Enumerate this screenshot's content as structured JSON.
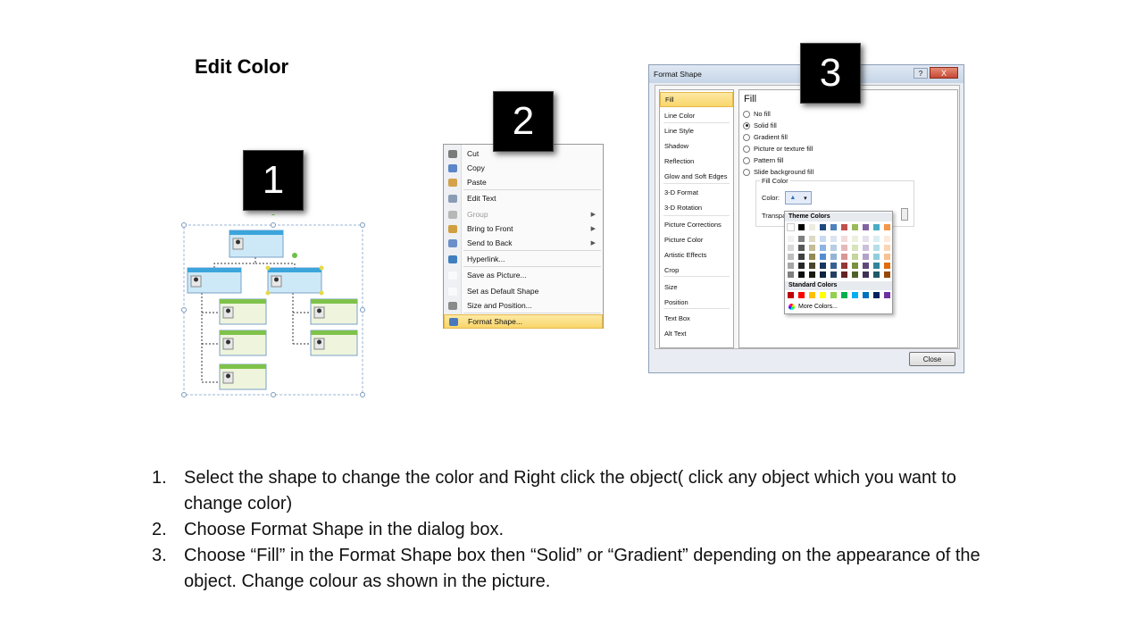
{
  "title": "Edit Color",
  "badges": [
    "1",
    "2",
    "3"
  ],
  "context_menu": {
    "items": [
      {
        "label": "Cut",
        "color": "#7a7a7a",
        "submenu": false,
        "disabled": false
      },
      {
        "label": "Copy",
        "color": "#5b85c7",
        "submenu": false,
        "disabled": false
      },
      {
        "label": "Paste",
        "color": "#d3a24a",
        "submenu": false,
        "disabled": false
      },
      {
        "label": "Edit Text",
        "color": "#8a9bb5",
        "submenu": false,
        "disabled": false
      },
      {
        "label": "Group",
        "color": "#b7b7b7",
        "submenu": true,
        "disabled": true
      },
      {
        "label": "Bring to Front",
        "color": "#d0a040",
        "submenu": true,
        "disabled": false
      },
      {
        "label": "Send to Back",
        "color": "#6b8fc9",
        "submenu": true,
        "disabled": false
      },
      {
        "label": "Hyperlink...",
        "color": "#3f7fbf",
        "submenu": false,
        "disabled": false
      },
      {
        "label": "Save as Picture...",
        "color": "#fafafa",
        "submenu": false,
        "disabled": false
      },
      {
        "label": "Set as Default Shape",
        "color": "#fafafa",
        "submenu": false,
        "disabled": false
      },
      {
        "label": "Size and Position...",
        "color": "#8a8a8a",
        "submenu": false,
        "disabled": false
      },
      {
        "label": "Format Shape...",
        "color": "#4a78c0",
        "submenu": false,
        "disabled": false
      }
    ]
  },
  "dialog": {
    "title": "Format Shape",
    "help": "?",
    "close_x": "X",
    "nav": [
      "Fill",
      "Line Color",
      "Line Style",
      "Shadow",
      "Reflection",
      "Glow and Soft Edges",
      "3-D Format",
      "3-D Rotation",
      "Picture Corrections",
      "Picture Color",
      "Artistic Effects",
      "Crop",
      "Size",
      "Position",
      "Text Box",
      "Alt Text"
    ],
    "selected_nav": "Fill",
    "panel_title": "Fill",
    "fill_options": [
      "No fill",
      "Solid fill",
      "Gradient fill",
      "Picture or texture fill",
      "Pattern fill",
      "Slide background fill"
    ],
    "selected_fill": "Solid fill",
    "fill_color_group": "Fill Color",
    "color_label": "Color:",
    "transparency_label": "Transpa",
    "close_button": "Close"
  },
  "palette": {
    "theme_header": "Theme Colors",
    "standard_header": "Standard Colors",
    "more_colors": "More Colors...",
    "theme_top": [
      "#ffffff",
      "#000000",
      "#eeece1",
      "#1f497d",
      "#4f81bd",
      "#c0504d",
      "#9bbb59",
      "#8064a2",
      "#4bacc6",
      "#f79646"
    ],
    "theme_columns": [
      [
        "#f2f2f2",
        "#d9d9d9",
        "#bfbfbf",
        "#a6a6a6",
        "#808080"
      ],
      [
        "#7f7f7f",
        "#595959",
        "#404040",
        "#262626",
        "#0d0d0d"
      ],
      [
        "#ddd9c3",
        "#c4bd97",
        "#948a54",
        "#4a452a",
        "#1d1b10"
      ],
      [
        "#c6d9f1",
        "#8db3e2",
        "#548dd4",
        "#17365d",
        "#0f243e"
      ],
      [
        "#dbe5f1",
        "#b8cce4",
        "#95b3d7",
        "#366092",
        "#244061"
      ],
      [
        "#f2dcdb",
        "#e6b9b8",
        "#d99694",
        "#953734",
        "#632423"
      ],
      [
        "#ebf1dd",
        "#d7e4bd",
        "#c3d69b",
        "#76923c",
        "#4f6228"
      ],
      [
        "#e5e0ec",
        "#ccc1d9",
        "#b2a2c7",
        "#5f497a",
        "#3f3151"
      ],
      [
        "#dbeef3",
        "#b7dde8",
        "#92cddc",
        "#31859b",
        "#205867"
      ],
      [
        "#fdeada",
        "#fbd5b5",
        "#fac08f",
        "#e36c09",
        "#974806"
      ]
    ],
    "standard": [
      "#c00000",
      "#ff0000",
      "#ffc000",
      "#ffff00",
      "#92d050",
      "#00b050",
      "#00b0f0",
      "#0070c0",
      "#002060",
      "#7030a0"
    ]
  },
  "steps": [
    {
      "num": "1.",
      "text": "Select the shape to change the color and Right click the object( click any object which you want to change color)"
    },
    {
      "num": "2.",
      "text": "Choose Format Shape in the dialog box."
    },
    {
      "num": "3.",
      "text": "Choose “Fill” in the Format Shape box then “Solid” or “Gradient” depending on the appearance of the object. Change colour as shown in the picture."
    }
  ]
}
